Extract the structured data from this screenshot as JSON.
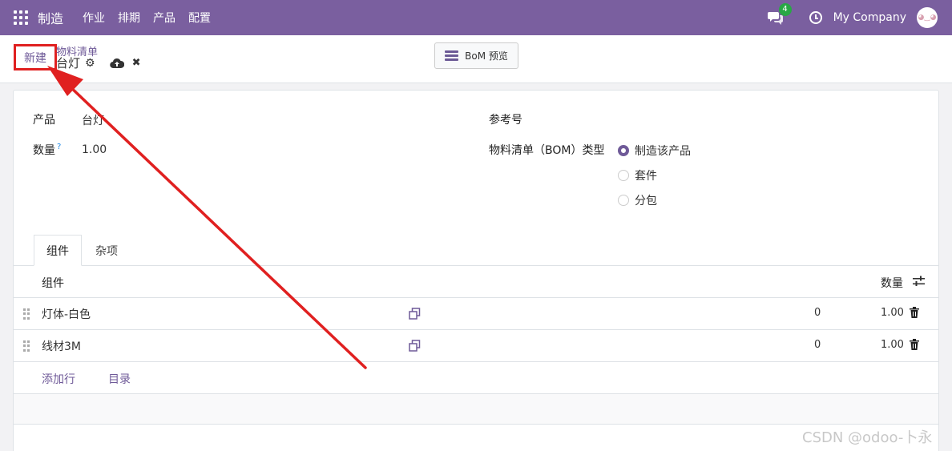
{
  "navbar": {
    "app_name": "制造",
    "menu": [
      "作业",
      "排期",
      "产品",
      "配置"
    ],
    "chat_badge": "4",
    "company": "My Company"
  },
  "control": {
    "new_label": "新建",
    "breadcrumb": "物料清单",
    "record_title": "台灯",
    "bom_preview_label": "BoM 预览"
  },
  "form": {
    "product_label": "产品",
    "product_value": "台灯",
    "quantity_label": "数量",
    "quantity_help": "?",
    "quantity_value": "1.00",
    "reference_label": "参考号",
    "bom_type_label": "物料清单（BOM）类型",
    "bom_type_options": [
      "制造该产品",
      "套件",
      "分包"
    ],
    "bom_type_selected": 0
  },
  "tabs": [
    {
      "label": "组件",
      "active": true
    },
    {
      "label": "杂项",
      "active": false
    }
  ],
  "table": {
    "col_component": "组件",
    "col_quantity": "数量",
    "rows": [
      {
        "name": "灯体-白色",
        "col3": "0",
        "quantity": "1.00"
      },
      {
        "name": "线材3M",
        "col3": "0",
        "quantity": "1.00"
      }
    ],
    "add_line_label": "添加行",
    "catalog_label": "目录"
  },
  "annotation_color": "#e02020",
  "accent_color": "#7a5f9f",
  "watermark": "CSDN @odoo-卜永"
}
